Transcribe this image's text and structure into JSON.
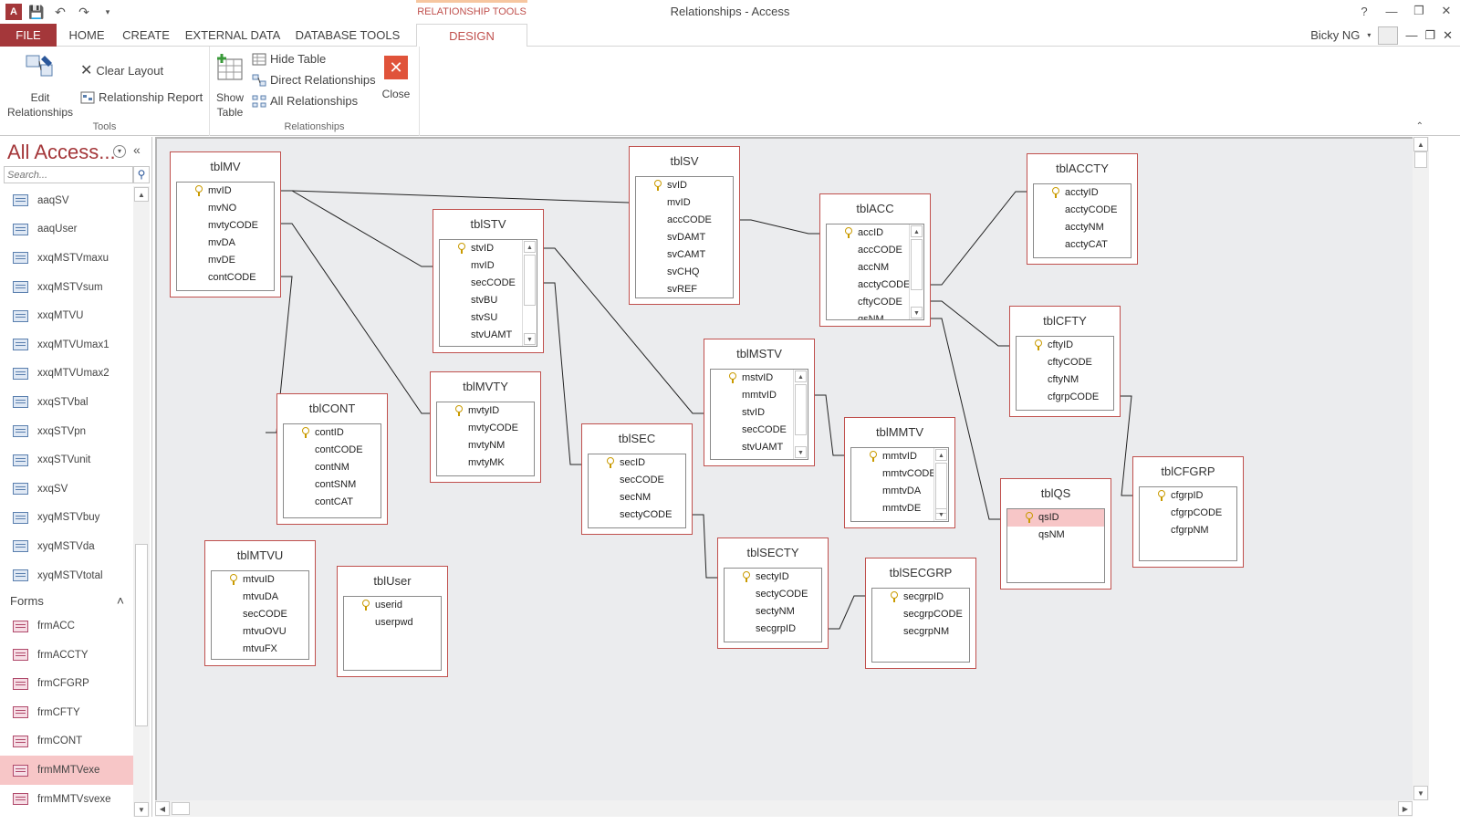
{
  "window": {
    "title": "Relationships - Access",
    "context_group": "RELATIONSHIP TOOLS",
    "user": "Bicky NG"
  },
  "tabs": [
    "FILE",
    "HOME",
    "CREATE",
    "EXTERNAL DATA",
    "DATABASE TOOLS",
    "DESIGN"
  ],
  "ribbon": {
    "tools_group": {
      "label": "Tools",
      "edit_relationships": "Edit Relationships",
      "clear_layout": "Clear Layout",
      "relationship_report": "Relationship Report"
    },
    "relationships_group": {
      "label": "Relationships",
      "show_table": "Show Table",
      "hide_table": "Hide Table",
      "direct_relationships": "Direct Relationships",
      "all_relationships": "All Relationships",
      "close": "Close"
    }
  },
  "nav": {
    "title": "All Access...",
    "search_placeholder": "Search...",
    "queries": [
      "aaqSV",
      "aaqUser",
      "xxqMSTVmaxu",
      "xxqMSTVsum",
      "xxqMTVU",
      "xxqMTVUmax1",
      "xxqMTVUmax2",
      "xxqSTVbal",
      "xxqSTVpn",
      "xxqSTVunit",
      "xxqSV",
      "xyqMSTVbuy",
      "xyqMSTVda",
      "xyqMSTVtotal"
    ],
    "forms_header": "Forms",
    "forms": [
      "frmACC",
      "frmACCTY",
      "frmCFGRP",
      "frmCFTY",
      "frmCONT",
      "frmMMTVexe",
      "frmMMTVsvexe"
    ],
    "selected_form": "frmMMTVexe"
  },
  "tables": [
    {
      "id": "tblMV",
      "name": "tblMV",
      "fields": [
        "mvID",
        "mvNO",
        "mvtyCODE",
        "mvDA",
        "mvDE",
        "contCODE"
      ],
      "key": 0,
      "scroll": false
    },
    {
      "id": "tblSTV",
      "name": "tblSTV",
      "fields": [
        "stvID",
        "mvID",
        "secCODE",
        "stvBU",
        "stvSU",
        "stvUAMT",
        "stvSU"
      ],
      "key": 0,
      "scroll": true
    },
    {
      "id": "tblSV",
      "name": "tblSV",
      "fields": [
        "svID",
        "mvID",
        "accCODE",
        "svDAMT",
        "svCAMT",
        "svCHQ",
        "svREF"
      ],
      "key": 0,
      "scroll": false
    },
    {
      "id": "tblACC",
      "name": "tblACC",
      "fields": [
        "accID",
        "accCODE",
        "accNM",
        "acctyCODE",
        "cftyCODE",
        "qsNM"
      ],
      "key": 0,
      "scroll": true
    },
    {
      "id": "tblACCTY",
      "name": "tblACCTY",
      "fields": [
        "acctyID",
        "acctyCODE",
        "acctyNM",
        "acctyCAT"
      ],
      "key": 0,
      "scroll": false
    },
    {
      "id": "tblCFTY",
      "name": "tblCFTY",
      "fields": [
        "cftyID",
        "cftyCODE",
        "cftyNM",
        "cfgrpCODE"
      ],
      "key": 0,
      "scroll": false
    },
    {
      "id": "tblCFGRP",
      "name": "tblCFGRP",
      "fields": [
        "cfgrpID",
        "cfgrpCODE",
        "cfgrpNM"
      ],
      "key": 0,
      "scroll": false
    },
    {
      "id": "tblQS",
      "name": "tblQS",
      "fields": [
        "qsID",
        "qsNM"
      ],
      "key": 0,
      "scroll": false,
      "selected": 0
    },
    {
      "id": "tblMSTV",
      "name": "tblMSTV",
      "fields": [
        "mstvID",
        "mmtvID",
        "stvID",
        "secCODE",
        "stvUAMT"
      ],
      "key": 0,
      "scroll": true
    },
    {
      "id": "tblMMTV",
      "name": "tblMMTV",
      "fields": [
        "mmtvID",
        "mmtvCODE",
        "mmtvDA",
        "mmtvDE",
        "mmtvCODE"
      ],
      "key": 0,
      "scroll": true
    },
    {
      "id": "tblMVTY",
      "name": "tblMVTY",
      "fields": [
        "mvtyID",
        "mvtyCODE",
        "mvtyNM",
        "mvtyMK"
      ],
      "key": 0,
      "scroll": false
    },
    {
      "id": "tblCONT",
      "name": "tblCONT",
      "fields": [
        "contID",
        "contCODE",
        "contNM",
        "contSNM",
        "contCAT"
      ],
      "key": 0,
      "scroll": false
    },
    {
      "id": "tblSEC",
      "name": "tblSEC",
      "fields": [
        "secID",
        "secCODE",
        "secNM",
        "sectyCODE"
      ],
      "key": 0,
      "scroll": false
    },
    {
      "id": "tblSECTY",
      "name": "tblSECTY",
      "fields": [
        "sectyID",
        "sectyCODE",
        "sectyNM",
        "secgrpID"
      ],
      "key": 0,
      "scroll": false
    },
    {
      "id": "tblSECGRP",
      "name": "tblSECGRP",
      "fields": [
        "secgrpID",
        "secgrpCODE",
        "secgrpNM"
      ],
      "key": 0,
      "scroll": false
    },
    {
      "id": "tblMTVU",
      "name": "tblMTVU",
      "fields": [
        "mtvuID",
        "mtvuDA",
        "secCODE",
        "mtvuOVU",
        "mtvuFX"
      ],
      "key": 0,
      "scroll": false
    },
    {
      "id": "tblUser",
      "name": "tblUser",
      "fields": [
        "userid",
        "userpwd"
      ],
      "key": 0,
      "scroll": false
    }
  ],
  "colors": {
    "accent": "#a4373a",
    "table_border": "#c0504d",
    "canvas": "#ebecee",
    "selection": "#f7c6c7"
  }
}
